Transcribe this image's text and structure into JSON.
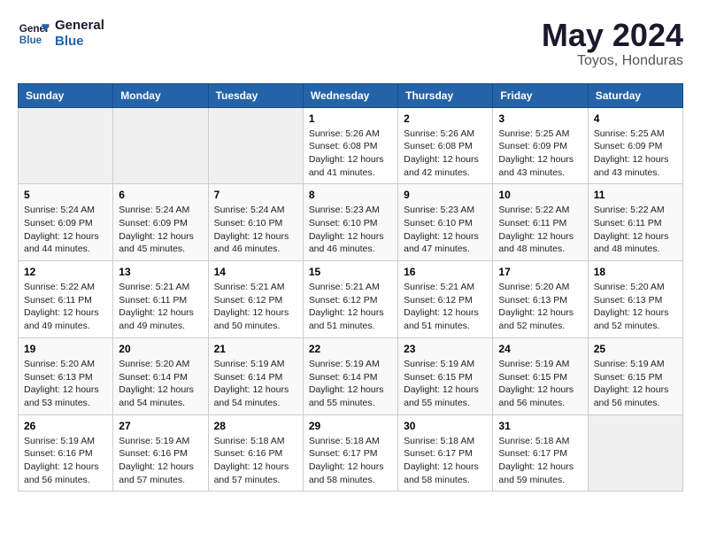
{
  "header": {
    "logo_line1": "General",
    "logo_line2": "Blue",
    "month": "May 2024",
    "location": "Toyos, Honduras"
  },
  "days_of_week": [
    "Sunday",
    "Monday",
    "Tuesday",
    "Wednesday",
    "Thursday",
    "Friday",
    "Saturday"
  ],
  "weeks": [
    [
      {
        "day": "",
        "empty": true
      },
      {
        "day": "",
        "empty": true
      },
      {
        "day": "",
        "empty": true
      },
      {
        "day": "1",
        "sunrise": "5:26 AM",
        "sunset": "6:08 PM",
        "daylight": "12 hours and 41 minutes."
      },
      {
        "day": "2",
        "sunrise": "5:26 AM",
        "sunset": "6:08 PM",
        "daylight": "12 hours and 42 minutes."
      },
      {
        "day": "3",
        "sunrise": "5:25 AM",
        "sunset": "6:09 PM",
        "daylight": "12 hours and 43 minutes."
      },
      {
        "day": "4",
        "sunrise": "5:25 AM",
        "sunset": "6:09 PM",
        "daylight": "12 hours and 43 minutes."
      }
    ],
    [
      {
        "day": "5",
        "sunrise": "5:24 AM",
        "sunset": "6:09 PM",
        "daylight": "12 hours and 44 minutes."
      },
      {
        "day": "6",
        "sunrise": "5:24 AM",
        "sunset": "6:09 PM",
        "daylight": "12 hours and 45 minutes."
      },
      {
        "day": "7",
        "sunrise": "5:24 AM",
        "sunset": "6:10 PM",
        "daylight": "12 hours and 46 minutes."
      },
      {
        "day": "8",
        "sunrise": "5:23 AM",
        "sunset": "6:10 PM",
        "daylight": "12 hours and 46 minutes."
      },
      {
        "day": "9",
        "sunrise": "5:23 AM",
        "sunset": "6:10 PM",
        "daylight": "12 hours and 47 minutes."
      },
      {
        "day": "10",
        "sunrise": "5:22 AM",
        "sunset": "6:11 PM",
        "daylight": "12 hours and 48 minutes."
      },
      {
        "day": "11",
        "sunrise": "5:22 AM",
        "sunset": "6:11 PM",
        "daylight": "12 hours and 48 minutes."
      }
    ],
    [
      {
        "day": "12",
        "sunrise": "5:22 AM",
        "sunset": "6:11 PM",
        "daylight": "12 hours and 49 minutes."
      },
      {
        "day": "13",
        "sunrise": "5:21 AM",
        "sunset": "6:11 PM",
        "daylight": "12 hours and 49 minutes."
      },
      {
        "day": "14",
        "sunrise": "5:21 AM",
        "sunset": "6:12 PM",
        "daylight": "12 hours and 50 minutes."
      },
      {
        "day": "15",
        "sunrise": "5:21 AM",
        "sunset": "6:12 PM",
        "daylight": "12 hours and 51 minutes."
      },
      {
        "day": "16",
        "sunrise": "5:21 AM",
        "sunset": "6:12 PM",
        "daylight": "12 hours and 51 minutes."
      },
      {
        "day": "17",
        "sunrise": "5:20 AM",
        "sunset": "6:13 PM",
        "daylight": "12 hours and 52 minutes."
      },
      {
        "day": "18",
        "sunrise": "5:20 AM",
        "sunset": "6:13 PM",
        "daylight": "12 hours and 52 minutes."
      }
    ],
    [
      {
        "day": "19",
        "sunrise": "5:20 AM",
        "sunset": "6:13 PM",
        "daylight": "12 hours and 53 minutes."
      },
      {
        "day": "20",
        "sunrise": "5:20 AM",
        "sunset": "6:14 PM",
        "daylight": "12 hours and 54 minutes."
      },
      {
        "day": "21",
        "sunrise": "5:19 AM",
        "sunset": "6:14 PM",
        "daylight": "12 hours and 54 minutes."
      },
      {
        "day": "22",
        "sunrise": "5:19 AM",
        "sunset": "6:14 PM",
        "daylight": "12 hours and 55 minutes."
      },
      {
        "day": "23",
        "sunrise": "5:19 AM",
        "sunset": "6:15 PM",
        "daylight": "12 hours and 55 minutes."
      },
      {
        "day": "24",
        "sunrise": "5:19 AM",
        "sunset": "6:15 PM",
        "daylight": "12 hours and 56 minutes."
      },
      {
        "day": "25",
        "sunrise": "5:19 AM",
        "sunset": "6:15 PM",
        "daylight": "12 hours and 56 minutes."
      }
    ],
    [
      {
        "day": "26",
        "sunrise": "5:19 AM",
        "sunset": "6:16 PM",
        "daylight": "12 hours and 56 minutes."
      },
      {
        "day": "27",
        "sunrise": "5:19 AM",
        "sunset": "6:16 PM",
        "daylight": "12 hours and 57 minutes."
      },
      {
        "day": "28",
        "sunrise": "5:18 AM",
        "sunset": "6:16 PM",
        "daylight": "12 hours and 57 minutes."
      },
      {
        "day": "29",
        "sunrise": "5:18 AM",
        "sunset": "6:17 PM",
        "daylight": "12 hours and 58 minutes."
      },
      {
        "day": "30",
        "sunrise": "5:18 AM",
        "sunset": "6:17 PM",
        "daylight": "12 hours and 58 minutes."
      },
      {
        "day": "31",
        "sunrise": "5:18 AM",
        "sunset": "6:17 PM",
        "daylight": "12 hours and 59 minutes."
      },
      {
        "day": "",
        "empty": true
      }
    ]
  ],
  "labels": {
    "sunrise_prefix": "Sunrise:",
    "sunset_prefix": "Sunset:",
    "daylight_prefix": "Daylight:"
  }
}
